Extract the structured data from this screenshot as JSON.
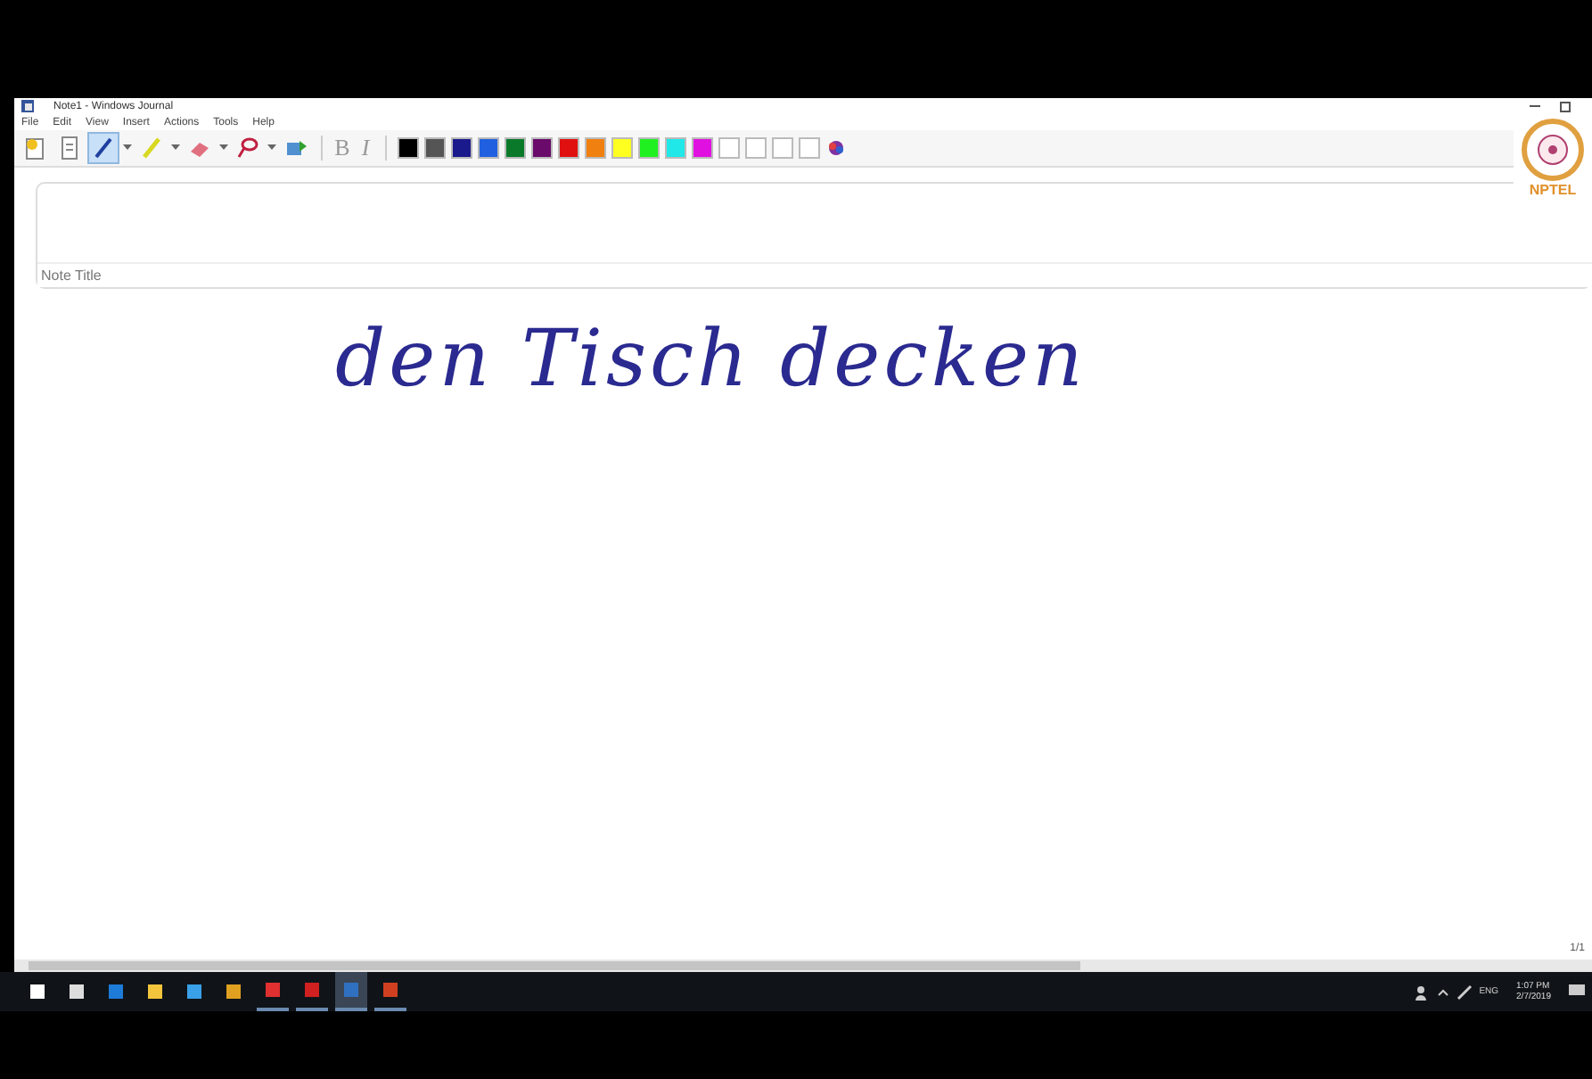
{
  "window": {
    "title": "Note1 - Windows Journal"
  },
  "menu": [
    "File",
    "Edit",
    "View",
    "Insert",
    "Actions",
    "Tools",
    "Help"
  ],
  "toolbar": {
    "tools": [
      {
        "kind": "new-note",
        "selected": false
      },
      {
        "kind": "page",
        "selected": false
      },
      {
        "kind": "pen",
        "selected": true
      },
      {
        "kind": "highlighter",
        "selected": false
      },
      {
        "kind": "eraser",
        "selected": false
      },
      {
        "kind": "lasso",
        "selected": false
      },
      {
        "kind": "insert",
        "selected": false
      }
    ],
    "format": [
      "B",
      "I"
    ],
    "colors": [
      {
        "color": "#000000"
      },
      {
        "color": "#555555"
      },
      {
        "color": "#1a1a8c"
      },
      {
        "color": "#2060e0"
      },
      {
        "color": "#0a7a2a"
      },
      {
        "color": "#6a0a6a"
      },
      {
        "color": "#e01010"
      },
      {
        "color": "#f08010"
      },
      {
        "color": "#ffff20"
      },
      {
        "color": "#20f020"
      },
      {
        "color": "#20e8e8"
      },
      {
        "color": "#e010e0"
      },
      {
        "color": "#ffffff"
      },
      {
        "color": "#ffffff"
      },
      {
        "color": "#ffffff"
      },
      {
        "color": "#ffffff"
      }
    ]
  },
  "logo": {
    "text": "NPTEL"
  },
  "note_title": {
    "placeholder": "Note Title"
  },
  "ink": "den Tisch decken",
  "page_indicator": "1/1",
  "taskbar": {
    "apps": [
      {
        "kind": "start",
        "running": false,
        "selected": false
      },
      {
        "kind": "taskview",
        "running": false,
        "selected": false
      },
      {
        "kind": "edge",
        "running": false,
        "selected": false
      },
      {
        "kind": "folder",
        "running": false,
        "selected": false
      },
      {
        "kind": "bird",
        "running": false,
        "selected": false
      },
      {
        "kind": "chrome",
        "running": false,
        "selected": false
      },
      {
        "kind": "c-app",
        "running": true,
        "selected": false
      },
      {
        "kind": "n-app",
        "running": true,
        "selected": false
      },
      {
        "kind": "journal",
        "running": true,
        "selected": true
      },
      {
        "kind": "ppt",
        "running": true,
        "selected": false
      }
    ],
    "language": "ENG",
    "time": "1:07 PM",
    "date": "2/7/2019"
  }
}
